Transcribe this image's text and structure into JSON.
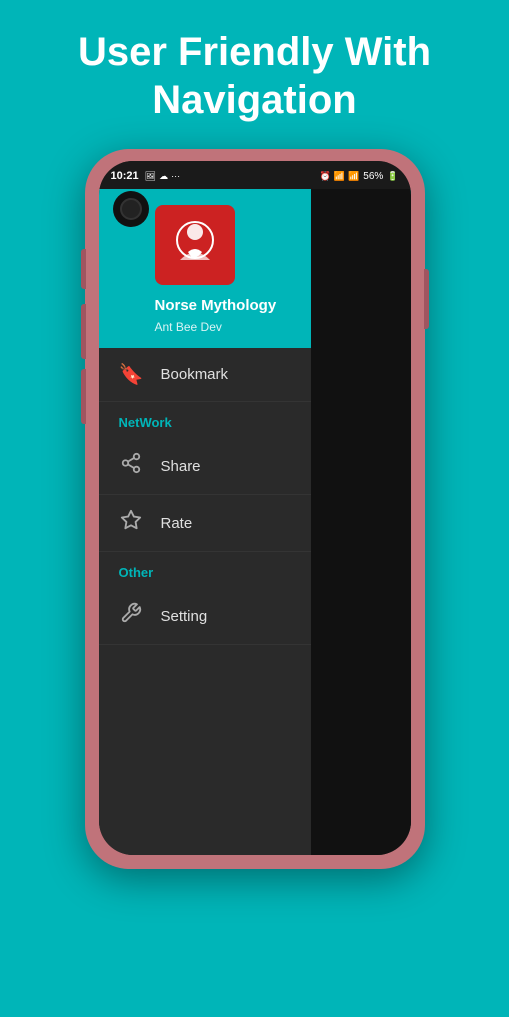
{
  "header": {
    "title_line1": "User Friendly With",
    "title_line2": "Navigation"
  },
  "status_bar": {
    "time": "10:21",
    "battery": "56%",
    "icons_left": [
      "📷",
      "🖼",
      "☁",
      "···"
    ],
    "icons_right": [
      "🔔",
      "📶",
      "📶"
    ]
  },
  "drawer": {
    "app_name": "Norse Mythology",
    "app_author": "Ant Bee Dev",
    "menu_items": [
      {
        "id": "bookmark",
        "icon": "bookmark",
        "label": "Bookmark",
        "section": null
      }
    ],
    "sections": [
      {
        "title": "NetWork",
        "items": [
          {
            "id": "share",
            "icon": "share",
            "label": "Share"
          },
          {
            "id": "rate",
            "icon": "star",
            "label": "Rate"
          }
        ]
      },
      {
        "title": "Other",
        "items": [
          {
            "id": "setting",
            "icon": "settings",
            "label": "Setting"
          }
        ]
      }
    ]
  }
}
